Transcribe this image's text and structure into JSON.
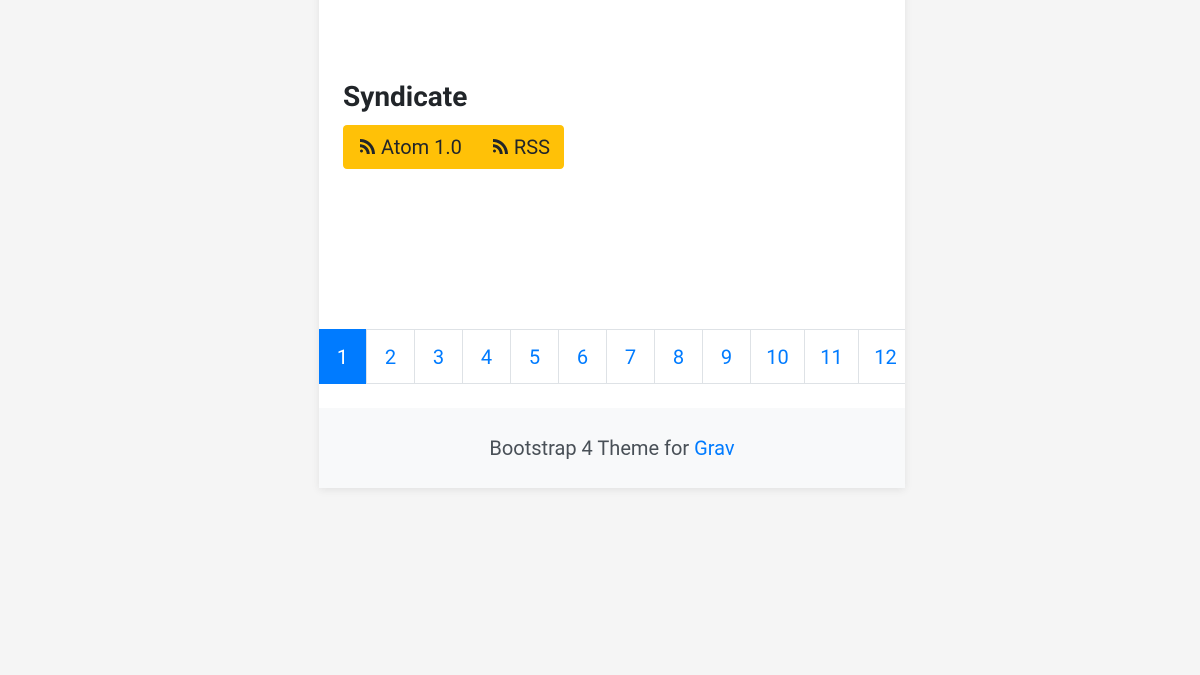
{
  "syndicate": {
    "heading": "Syndicate",
    "feeds": [
      {
        "label": "Atom 1.0"
      },
      {
        "label": "RSS"
      }
    ]
  },
  "pagination": {
    "pages": [
      "1",
      "2",
      "3",
      "4",
      "5",
      "6",
      "7",
      "8",
      "9",
      "10",
      "11",
      "12"
    ],
    "active_index": 0
  },
  "footer": {
    "text_prefix": "Bootstrap 4 Theme for ",
    "link_label": "Grav"
  }
}
